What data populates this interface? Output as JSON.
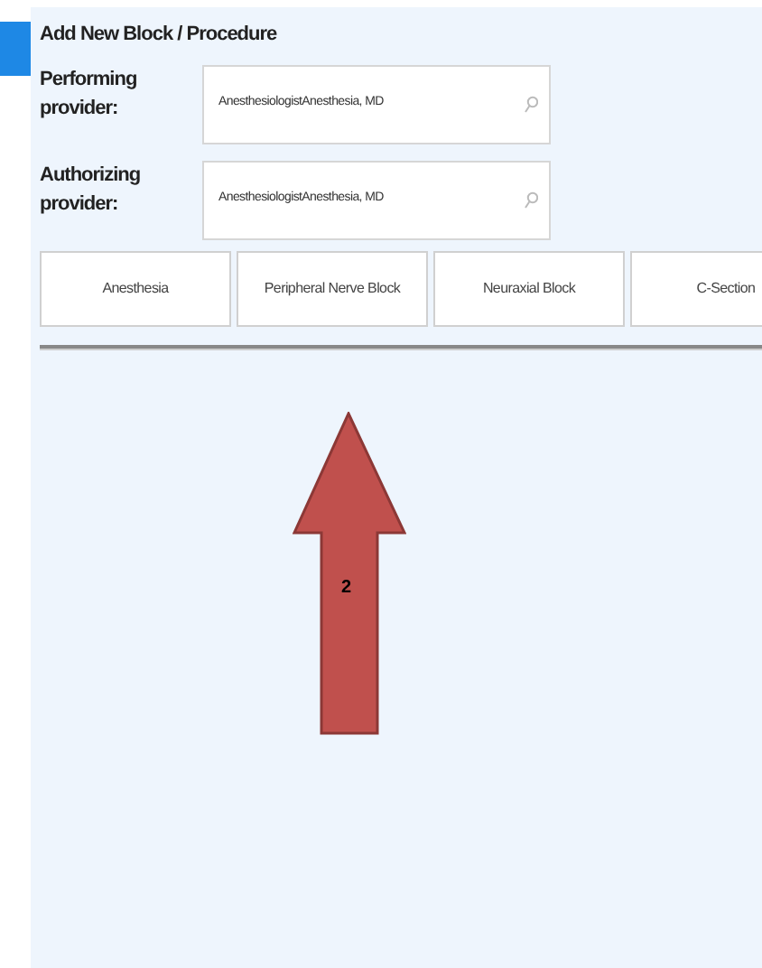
{
  "title": "Add New Block / Procedure",
  "fields": [
    {
      "label": "Performing provider:",
      "value": "AnesthesiologistAnesthesia, MD"
    },
    {
      "label": "Authorizing provider:",
      "value": "AnesthesiologistAnesthesia, MD"
    }
  ],
  "procedure_buttons": [
    "Anesthesia",
    "Peripheral Nerve Block",
    "Neuraxial Block",
    "C-Section"
  ],
  "annotation": {
    "label": "2"
  }
}
